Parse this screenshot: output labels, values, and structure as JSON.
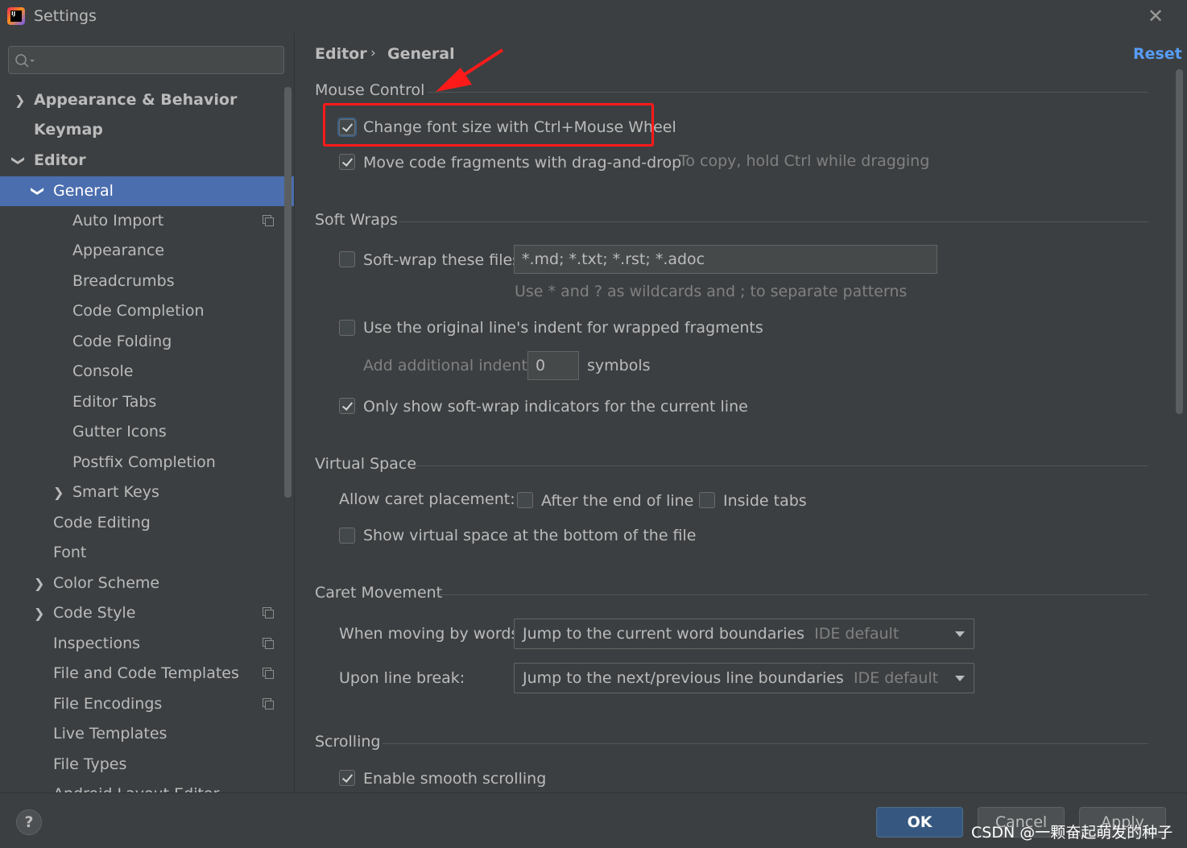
{
  "window": {
    "title": "Settings"
  },
  "search": {
    "placeholder": ""
  },
  "sidebar": {
    "items": [
      {
        "label": "Appearance & Behavior"
      },
      {
        "label": "Keymap"
      },
      {
        "label": "Editor"
      },
      {
        "label": "General"
      },
      {
        "label": "Auto Import"
      },
      {
        "label": "Appearance"
      },
      {
        "label": "Breadcrumbs"
      },
      {
        "label": "Code Completion"
      },
      {
        "label": "Code Folding"
      },
      {
        "label": "Console"
      },
      {
        "label": "Editor Tabs"
      },
      {
        "label": "Gutter Icons"
      },
      {
        "label": "Postfix Completion"
      },
      {
        "label": "Smart Keys"
      },
      {
        "label": "Code Editing"
      },
      {
        "label": "Font"
      },
      {
        "label": "Color Scheme"
      },
      {
        "label": "Code Style"
      },
      {
        "label": "Inspections"
      },
      {
        "label": "File and Code Templates"
      },
      {
        "label": "File Encodings"
      },
      {
        "label": "Live Templates"
      },
      {
        "label": "File Types"
      },
      {
        "label": "Android Layout Editor"
      }
    ]
  },
  "breadcrumb": {
    "parent": "Editor",
    "current": "General",
    "separator": "›"
  },
  "header": {
    "reset_label": "Reset"
  },
  "mouse_control": {
    "title": "Mouse Control",
    "change_font": {
      "label": "Change font size with Ctrl+Mouse Wheel",
      "checked": true
    },
    "drag_drop": {
      "label": "Move code fragments with drag-and-drop",
      "checked": true,
      "hint": "To copy, hold Ctrl while dragging"
    }
  },
  "soft_wraps": {
    "title": "Soft Wraps",
    "wrap_files": {
      "label": "Soft-wrap these files:",
      "checked": false,
      "value": "*.md; *.txt; *.rst; *.adoc"
    },
    "wildcard_hint": "Use * and ? as wildcards and ; to separate patterns",
    "original_indent": {
      "label": "Use the original line's indent for wrapped fragments",
      "checked": false
    },
    "additional_indent": {
      "label": "Add additional indent:",
      "value": "0",
      "unit": "symbols"
    },
    "only_current": {
      "label": "Only show soft-wrap indicators for the current line",
      "checked": true
    }
  },
  "virtual_space": {
    "title": "Virtual Space",
    "caret_label": "Allow caret placement:",
    "after_end": {
      "label": "After the end of line",
      "checked": false
    },
    "inside_tabs": {
      "label": "Inside tabs",
      "checked": false
    },
    "show_bottom": {
      "label": "Show virtual space at the bottom of the file",
      "checked": false
    }
  },
  "caret_movement": {
    "title": "Caret Movement",
    "by_words": {
      "label": "When moving by words:",
      "value": "Jump to the current word boundaries",
      "note": "IDE default"
    },
    "line_break": {
      "label": "Upon line break:",
      "value": "Jump to the next/previous line boundaries",
      "note": "IDE default"
    }
  },
  "scrolling": {
    "title": "Scrolling",
    "smooth": {
      "label": "Enable smooth scrolling",
      "checked": true
    }
  },
  "footer": {
    "help_label": "?",
    "ok_label": "OK",
    "cancel_label": "Cancel",
    "apply_label": "Apply",
    "watermark": "CSDN @一颗奋起萌发的种子"
  },
  "colors": {
    "background": "#3c3f41",
    "selection": "#4b6eaf",
    "link": "#589df6",
    "annotation": "#ff1a1a",
    "ok_button": "#365880"
  }
}
